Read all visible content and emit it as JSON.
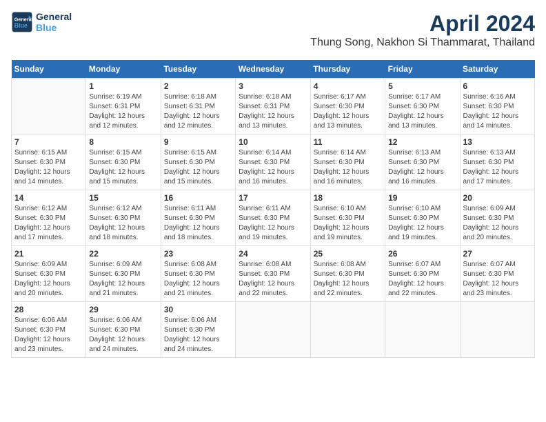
{
  "logo": {
    "line1": "General",
    "line2": "Blue",
    "icon_color": "#4a9fd4"
  },
  "title": "April 2024",
  "location": "Thung Song, Nakhon Si Thammarat, Thailand",
  "days_of_week": [
    "Sunday",
    "Monday",
    "Tuesday",
    "Wednesday",
    "Thursday",
    "Friday",
    "Saturday"
  ],
  "weeks": [
    [
      {
        "day": "",
        "info": ""
      },
      {
        "day": "1",
        "info": "Sunrise: 6:19 AM\nSunset: 6:31 PM\nDaylight: 12 hours\nand 12 minutes."
      },
      {
        "day": "2",
        "info": "Sunrise: 6:18 AM\nSunset: 6:31 PM\nDaylight: 12 hours\nand 12 minutes."
      },
      {
        "day": "3",
        "info": "Sunrise: 6:18 AM\nSunset: 6:31 PM\nDaylight: 12 hours\nand 13 minutes."
      },
      {
        "day": "4",
        "info": "Sunrise: 6:17 AM\nSunset: 6:30 PM\nDaylight: 12 hours\nand 13 minutes."
      },
      {
        "day": "5",
        "info": "Sunrise: 6:17 AM\nSunset: 6:30 PM\nDaylight: 12 hours\nand 13 minutes."
      },
      {
        "day": "6",
        "info": "Sunrise: 6:16 AM\nSunset: 6:30 PM\nDaylight: 12 hours\nand 14 minutes."
      }
    ],
    [
      {
        "day": "7",
        "info": "Sunrise: 6:15 AM\nSunset: 6:30 PM\nDaylight: 12 hours\nand 14 minutes."
      },
      {
        "day": "8",
        "info": "Sunrise: 6:15 AM\nSunset: 6:30 PM\nDaylight: 12 hours\nand 15 minutes."
      },
      {
        "day": "9",
        "info": "Sunrise: 6:15 AM\nSunset: 6:30 PM\nDaylight: 12 hours\nand 15 minutes."
      },
      {
        "day": "10",
        "info": "Sunrise: 6:14 AM\nSunset: 6:30 PM\nDaylight: 12 hours\nand 16 minutes."
      },
      {
        "day": "11",
        "info": "Sunrise: 6:14 AM\nSunset: 6:30 PM\nDaylight: 12 hours\nand 16 minutes."
      },
      {
        "day": "12",
        "info": "Sunrise: 6:13 AM\nSunset: 6:30 PM\nDaylight: 12 hours\nand 16 minutes."
      },
      {
        "day": "13",
        "info": "Sunrise: 6:13 AM\nSunset: 6:30 PM\nDaylight: 12 hours\nand 17 minutes."
      }
    ],
    [
      {
        "day": "14",
        "info": "Sunrise: 6:12 AM\nSunset: 6:30 PM\nDaylight: 12 hours\nand 17 minutes."
      },
      {
        "day": "15",
        "info": "Sunrise: 6:12 AM\nSunset: 6:30 PM\nDaylight: 12 hours\nand 18 minutes."
      },
      {
        "day": "16",
        "info": "Sunrise: 6:11 AM\nSunset: 6:30 PM\nDaylight: 12 hours\nand 18 minutes."
      },
      {
        "day": "17",
        "info": "Sunrise: 6:11 AM\nSunset: 6:30 PM\nDaylight: 12 hours\nand 19 minutes."
      },
      {
        "day": "18",
        "info": "Sunrise: 6:10 AM\nSunset: 6:30 PM\nDaylight: 12 hours\nand 19 minutes."
      },
      {
        "day": "19",
        "info": "Sunrise: 6:10 AM\nSunset: 6:30 PM\nDaylight: 12 hours\nand 19 minutes."
      },
      {
        "day": "20",
        "info": "Sunrise: 6:09 AM\nSunset: 6:30 PM\nDaylight: 12 hours\nand 20 minutes."
      }
    ],
    [
      {
        "day": "21",
        "info": "Sunrise: 6:09 AM\nSunset: 6:30 PM\nDaylight: 12 hours\nand 20 minutes."
      },
      {
        "day": "22",
        "info": "Sunrise: 6:09 AM\nSunset: 6:30 PM\nDaylight: 12 hours\nand 21 minutes."
      },
      {
        "day": "23",
        "info": "Sunrise: 6:08 AM\nSunset: 6:30 PM\nDaylight: 12 hours\nand 21 minutes."
      },
      {
        "day": "24",
        "info": "Sunrise: 6:08 AM\nSunset: 6:30 PM\nDaylight: 12 hours\nand 22 minutes."
      },
      {
        "day": "25",
        "info": "Sunrise: 6:08 AM\nSunset: 6:30 PM\nDaylight: 12 hours\nand 22 minutes."
      },
      {
        "day": "26",
        "info": "Sunrise: 6:07 AM\nSunset: 6:30 PM\nDaylight: 12 hours\nand 22 minutes."
      },
      {
        "day": "27",
        "info": "Sunrise: 6:07 AM\nSunset: 6:30 PM\nDaylight: 12 hours\nand 23 minutes."
      }
    ],
    [
      {
        "day": "28",
        "info": "Sunrise: 6:06 AM\nSunset: 6:30 PM\nDaylight: 12 hours\nand 23 minutes."
      },
      {
        "day": "29",
        "info": "Sunrise: 6:06 AM\nSunset: 6:30 PM\nDaylight: 12 hours\nand 24 minutes."
      },
      {
        "day": "30",
        "info": "Sunrise: 6:06 AM\nSunset: 6:30 PM\nDaylight: 12 hours\nand 24 minutes."
      },
      {
        "day": "",
        "info": ""
      },
      {
        "day": "",
        "info": ""
      },
      {
        "day": "",
        "info": ""
      },
      {
        "day": "",
        "info": ""
      }
    ]
  ]
}
